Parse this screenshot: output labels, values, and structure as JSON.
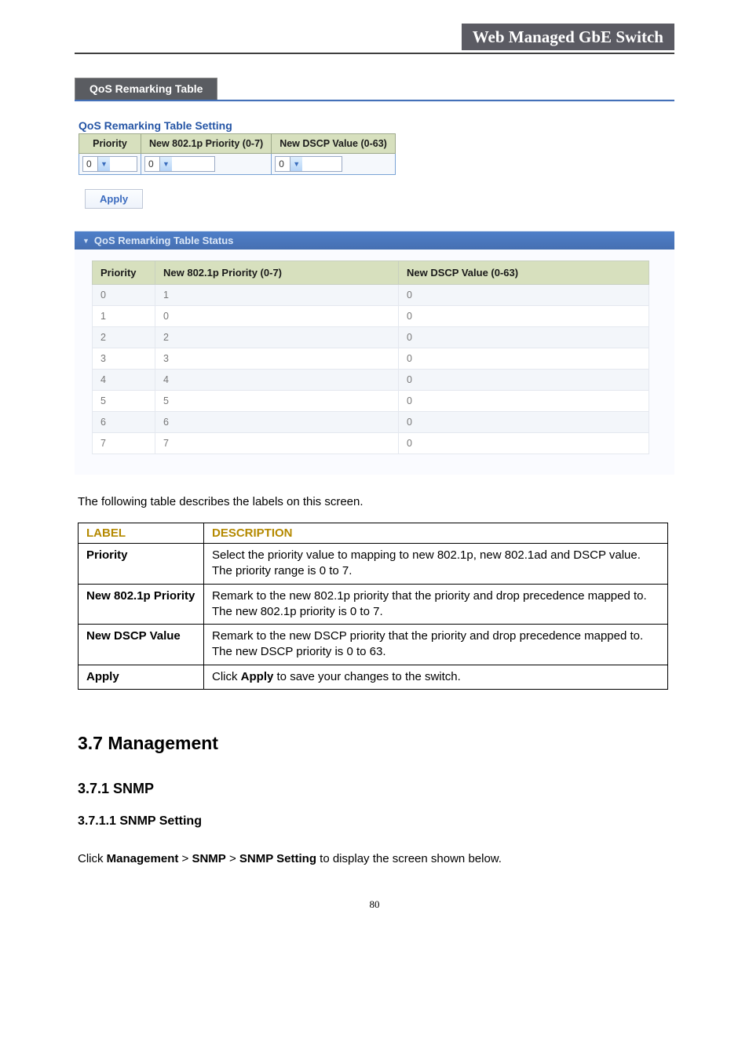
{
  "header": {
    "title": "Web Managed GbE Switch"
  },
  "tab": {
    "label": "QoS Remarking Table"
  },
  "setting": {
    "title": "QoS Remarking Table Setting",
    "headers": {
      "priority": "Priority",
      "new802": "New 802.1p Priority (0-7)",
      "newdscp": "New DSCP Value (0-63)"
    },
    "values": {
      "priority": "0",
      "new802": "0",
      "newdscp": "0"
    }
  },
  "apply_label": "Apply",
  "status": {
    "title": "QoS Remarking Table Status",
    "headers": {
      "priority": "Priority",
      "new802": "New 802.1p Priority (0-7)",
      "newdscp": "New DSCP Value (0-63)"
    },
    "rows": [
      {
        "priority": "0",
        "new802": "1",
        "newdscp": "0"
      },
      {
        "priority": "1",
        "new802": "0",
        "newdscp": "0"
      },
      {
        "priority": "2",
        "new802": "2",
        "newdscp": "0"
      },
      {
        "priority": "3",
        "new802": "3",
        "newdscp": "0"
      },
      {
        "priority": "4",
        "new802": "4",
        "newdscp": "0"
      },
      {
        "priority": "5",
        "new802": "5",
        "newdscp": "0"
      },
      {
        "priority": "6",
        "new802": "6",
        "newdscp": "0"
      },
      {
        "priority": "7",
        "new802": "7",
        "newdscp": "0"
      }
    ]
  },
  "desc_intro": "The following table describes the labels on this screen.",
  "desc_headers": {
    "label": "LABEL",
    "description": "DESCRIPTION"
  },
  "desc_rows": [
    {
      "label": "Priority",
      "desc": "Select the priority value to mapping to new 802.1p, new 802.1ad and DSCP value. The priority range is 0 to 7."
    },
    {
      "label": "New 802.1p Priority",
      "desc": "Remark to the new 802.1p priority that the priority and drop precedence mapped to. The new 802.1p priority is 0 to 7."
    },
    {
      "label": "New DSCP Value",
      "desc": "Remark to the new DSCP priority that the priority and drop precedence mapped to. The new DSCP priority is 0 to 63."
    },
    {
      "label": "Apply",
      "desc_prefix": "Click ",
      "desc_bold": "Apply",
      "desc_suffix": " to save your changes to the switch."
    }
  ],
  "sections": {
    "h2": "3.7 Management",
    "h3": "3.7.1 SNMP",
    "h4": "3.7.1.1 SNMP Setting"
  },
  "nav": {
    "prefix": "Click ",
    "b1": "Management",
    "gt1": " > ",
    "b2": "SNMP",
    "gt2": " > ",
    "b3": "SNMP Setting",
    "suffix": " to display the screen shown below."
  },
  "page_number": "80"
}
